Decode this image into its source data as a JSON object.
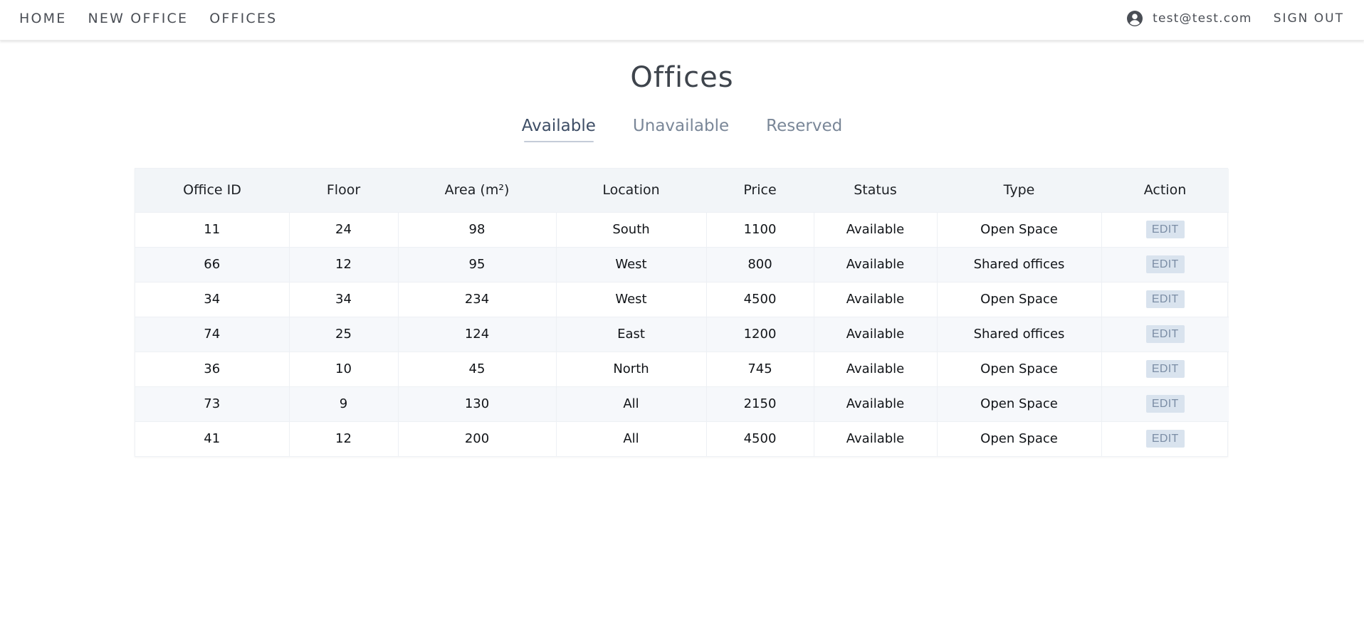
{
  "nav": {
    "links": [
      "HOME",
      "NEW OFFICE",
      "OFFICES"
    ],
    "user_email": "test@test.com",
    "signout_label": "SIGN OUT",
    "user_icon": "account-circle-icon"
  },
  "page": {
    "title": "Offices"
  },
  "tabs": [
    {
      "label": "Available",
      "active": true
    },
    {
      "label": "Unavailable",
      "active": false
    },
    {
      "label": "Reserved",
      "active": false
    }
  ],
  "table": {
    "headers": [
      "Office ID",
      "Floor",
      "Area (m²)",
      "Location",
      "Price",
      "Status",
      "Type",
      "Action"
    ],
    "rows": [
      {
        "office_id": "11",
        "floor": "24",
        "area": "98",
        "location": "South",
        "price": "1100",
        "status": "Available",
        "type": "Open Space",
        "action": "EDIT"
      },
      {
        "office_id": "66",
        "floor": "12",
        "area": "95",
        "location": "West",
        "price": "800",
        "status": "Available",
        "type": "Shared offices",
        "action": "EDIT"
      },
      {
        "office_id": "34",
        "floor": "34",
        "area": "234",
        "location": "West",
        "price": "4500",
        "status": "Available",
        "type": "Open Space",
        "action": "EDIT"
      },
      {
        "office_id": "74",
        "floor": "25",
        "area": "124",
        "location": "East",
        "price": "1200",
        "status": "Available",
        "type": "Shared offices",
        "action": "EDIT"
      },
      {
        "office_id": "36",
        "floor": "10",
        "area": "45",
        "location": "North",
        "price": "745",
        "status": "Available",
        "type": "Open Space",
        "action": "EDIT"
      },
      {
        "office_id": "73",
        "floor": "9",
        "area": "130",
        "location": "All",
        "price": "2150",
        "status": "Available",
        "type": "Open Space",
        "action": "EDIT"
      },
      {
        "office_id": "41",
        "floor": "12",
        "area": "200",
        "location": "All",
        "price": "4500",
        "status": "Available",
        "type": "Open Space",
        "action": "EDIT"
      }
    ]
  }
}
